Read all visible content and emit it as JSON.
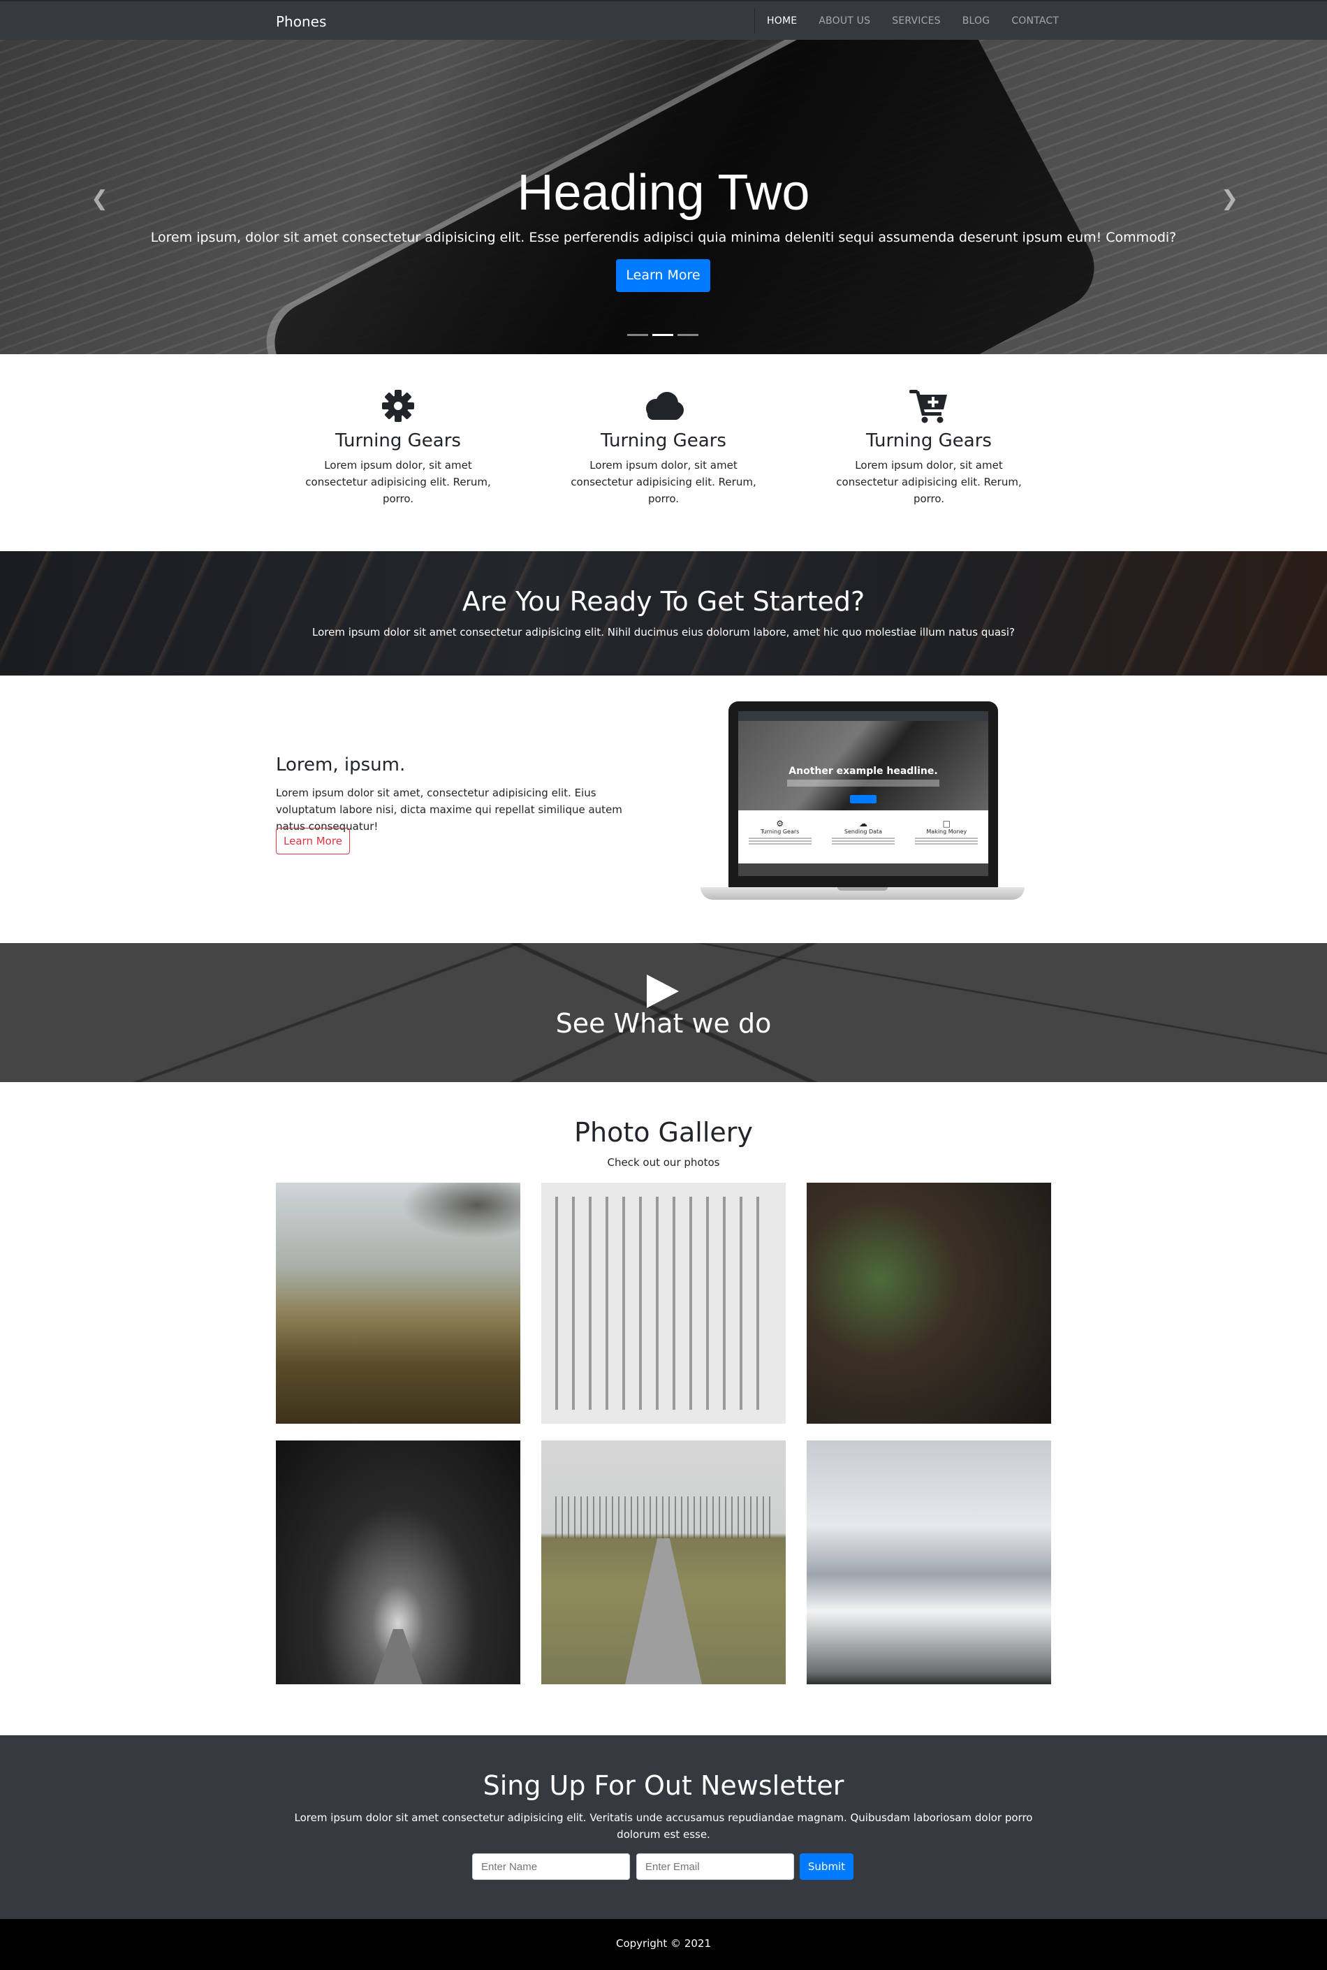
{
  "navbar": {
    "brand": "Phones",
    "links": [
      "HOME",
      "ABOUT US",
      "SERVICES",
      "BLOG",
      "CONTACT"
    ],
    "active_index": 0
  },
  "hero": {
    "title": "Heading Two",
    "text": "Lorem ipsum, dolor sit amet consectetur adipisicing elit. Esse perferendis adipisci quia minima deleniti sequi assumenda deserunt ipsum eum! Commodi?",
    "button_label": "Learn More",
    "slide_count": 3,
    "active_slide": 1,
    "prev_icon": "chevron-left-icon",
    "next_icon": "chevron-right-icon"
  },
  "features": [
    {
      "icon": "gear-icon",
      "title": "Turning Gears",
      "text": "Lorem ipsum dolor, sit amet consectetur adipisicing elit. Rerum, porro."
    },
    {
      "icon": "cloud-icon",
      "title": "Turning Gears",
      "text": "Lorem ipsum dolor, sit amet consectetur adipisicing elit. Rerum, porro."
    },
    {
      "icon": "cart-plus-icon",
      "title": "Turning Gears",
      "text": "Lorem ipsum dolor, sit amet consectetur adipisicing elit. Rerum, porro."
    }
  ],
  "cta": {
    "title": "Are You Ready To Get Started?",
    "text": "Lorem ipsum dolor sit amet consectetur adipisicing elit. Nihil ducimus eius dolorum labore, amet hic quo molestiae illum natus quasi?"
  },
  "about": {
    "title": "Lorem, ipsum.",
    "text": "Lorem ipsum dolor sit amet, consectetur adipisicing elit. Eius voluptatum labore nisi, dicta maxime qui repellat similique autem natus consequatur!",
    "button_label": "Learn More",
    "laptop_screen": {
      "headline": "Another example headline.",
      "features": [
        "Turning Gears",
        "Sending Data",
        "Making Money"
      ]
    }
  },
  "video": {
    "title": "See What we do",
    "icon": "play-icon"
  },
  "gallery": {
    "title": "Photo Gallery",
    "subtitle": "Check out our photos",
    "photos": [
      "landscape-hills",
      "typewriter-parts",
      "forest-floor",
      "tree-tunnel-road",
      "path-with-trees",
      "snowy-mountains"
    ]
  },
  "newsletter": {
    "title": "Sing Up For Out Newsletter",
    "text": "Lorem ipsum dolor sit amet consectetur adipisicing elit. Veritatis unde accusamus repudiandae magnam. Quibusdam laboriosam dolor porro dolorum est esse.",
    "name_placeholder": "Enter Name",
    "email_placeholder": "Enter Email",
    "submit_label": "Submit"
  },
  "footer": {
    "copyright": "Copyright © 2021"
  },
  "colors": {
    "navbar": "#343a40",
    "primary": "#007bff",
    "danger": "#dc3545",
    "footer": "#000000"
  }
}
